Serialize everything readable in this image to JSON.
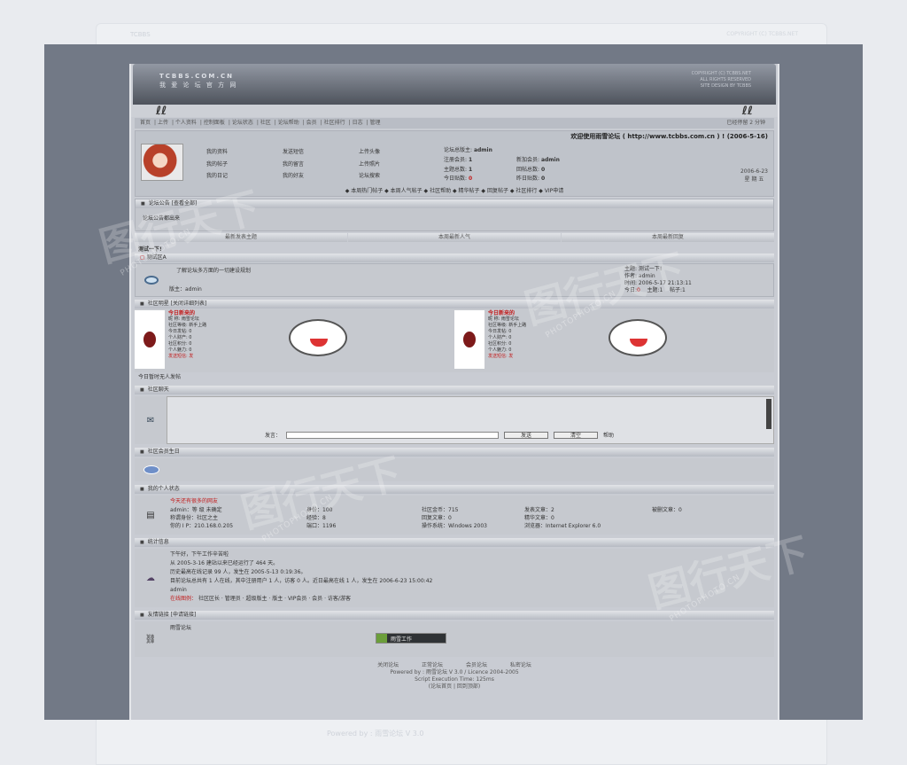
{
  "ghost": {
    "top_title": "TCBBS",
    "top_right": "COPYRIGHT (C) TCBBS.NET",
    "bottom_text": "Powered by : 雨雪论坛 V 3.0"
  },
  "header": {
    "logo_line1": "TCBBS.COM.CN",
    "logo_line2": "我 爱 论 坛 官 方 网",
    "copyright": [
      "COPYRIGHT (C) TCBBS.NET",
      "ALL RIGHTS RESERVED",
      "SITE DESIGN BY TCBBS"
    ]
  },
  "nav": {
    "items": [
      "首页",
      "上传",
      "个人资料",
      "控制面板",
      "论坛状态",
      "社区",
      "论坛帮助",
      "会员",
      "社区排行",
      "日志",
      "管理"
    ],
    "right": "已经停留 2 分钟"
  },
  "welcome": {
    "text": "欢迎使用雨雪论坛 ( http://www.tcbbs.com.cn ) !",
    "date": "(2006-5-16)"
  },
  "user": {
    "links": [
      "我的资料",
      "发送短信",
      "上传头像",
      "我的帖子",
      "我的留言",
      "上传照片",
      "我的日记",
      "我的好友",
      "论坛搜索"
    ],
    "stats": [
      {
        "k": "论坛总版主:",
        "v": "admin"
      },
      {
        "k": "注册会员:",
        "v": "1"
      },
      {
        "k": "新加会员:",
        "v": "admin"
      },
      {
        "k": "主题总数:",
        "v": "1"
      },
      {
        "k": "回帖总数:",
        "v": "0"
      },
      {
        "k": "今日贴数:",
        "v": "0"
      },
      {
        "k": "昨日贴数:",
        "v": "0"
      }
    ],
    "date": "2006-6-23",
    "weekday": "星 期 五"
  },
  "quick_links": "◆ 本周热门帖子  ◆ 本周人气帖子  ◆ 社区帮助  ◆ 精华帖子  ◆ 回复帖子  ◆ 社区排行  ◆ VIP申请",
  "announce": {
    "title": "论坛公告",
    "link": "[查看全部]",
    "body": "论坛公告都出来"
  },
  "tabs": [
    "最新发表主题",
    "本周最新人气",
    "本周最新回复"
  ],
  "category": "测试一下!",
  "forum": {
    "name": "测试区A",
    "desc": "了解论坛多方面的一切建设规划",
    "moderator": "版主：admin",
    "last_title": "主题: 测试一下!",
    "last_author": "作者: admin",
    "last_time": "时间: 2006-5-17 21:13:11",
    "today_label": "今日:",
    "today": "0",
    "topics_label": "主题:",
    "topics": "1",
    "posts_label": "帖子:",
    "posts": "1"
  },
  "stars": {
    "title": "社区明星",
    "link": "[关闭详细列表]",
    "items": [
      {
        "label": "今日新来的",
        "lines": [
          "昵  称: 雨雪论坛",
          "社区等级: 新手上路",
          "今日发帖: 0",
          "个人财产: 0",
          "社区积分: 0",
          "个人魅力: 0",
          "发送短信: 发"
        ]
      },
      {
        "label": "今日新来的",
        "lines": [
          "昵  称: 雨雪论坛",
          "社区等级: 新手上路",
          "今日发帖: 0",
          "个人财产: 0",
          "社区积分: 0",
          "个人魅力: 0",
          "发送短信: 发"
        ]
      }
    ],
    "footer": "今日暂时无人发帖"
  },
  "chat": {
    "title": "社区聊天",
    "say": "发言：",
    "send": "发送",
    "clear": "清空",
    "help": "帮助"
  },
  "birthday": {
    "title": "社区会员生日"
  },
  "personal": {
    "title": "我的个人状态",
    "subtitle": "今天还有很多的网友",
    "cells": [
      "admin：等 级 未确定",
      "身份：100",
      "社区金币：715",
      "发表文章：2",
      "被删文章：0",
      "称谓身份：社区之主",
      "经验：8",
      "回复文章：0",
      "精华文章：0",
      "你的 I P：210.168.0.205",
      "端口：1196",
      "操作系统：Windows 2003",
      "浏览器：Internet Explorer 6.0",
      ""
    ]
  },
  "stat": {
    "title": "统计信息",
    "lines": [
      "下午好，下午工作辛苦啦",
      "从 2005-3-16 建站以来已经运行了 464 天。",
      "历史最高在线记录 99 人，发生在 2005-5-13 0:19:36。",
      "目前论坛总共有 1 人在线，其中注册用户 1 人，访客 0 人。近日最高在线 1 人，发生在 2006-6-23 15:00:42"
    ],
    "online_user": "admin",
    "legend": [
      "在线图例：",
      "社区区长",
      "管理员",
      "超级版主",
      "版主",
      "VIP会员",
      "会员",
      "访客/游客"
    ]
  },
  "friend": {
    "title": "友情链接",
    "link": "[申请链接]",
    "site": "雨雪论坛",
    "badge": "雨雪工作"
  },
  "footer": {
    "legend": [
      "关闭论坛",
      "正常论坛",
      "会员论坛",
      "私密论坛"
    ],
    "powered": "Powered by : 雨雪论坛 V 3.0 / Licence 2004-2005",
    "exec": "Script Execution Time: 125ms",
    "extra": "(论坛首页 | 回到顶部)"
  },
  "watermark": {
    "main": "图行天下",
    "sub": "PHOTOPHOTO.CN"
  },
  "colors": {
    "outer": "#727986",
    "page": "#c9ccd3",
    "accent_red": "#c21d1d"
  }
}
